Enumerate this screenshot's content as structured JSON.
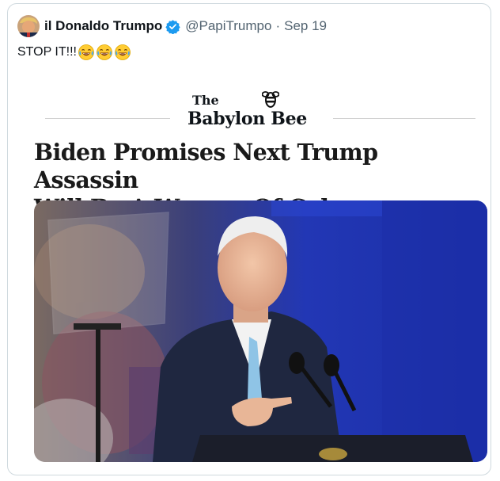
{
  "tweet": {
    "display_name": "il Donaldo Trumpo",
    "handle": "@PapiTrumpo",
    "separator": "·",
    "date": "Sep 19",
    "text": "STOP IT!!!",
    "emojis": [
      "face-with-tears-of-joy",
      "face-with-tears-of-joy",
      "face-with-tears-of-joy"
    ],
    "verified": true
  },
  "card": {
    "logo_the": "The",
    "logo_name": "Babylon Bee",
    "headline_line1": "Biden Promises Next Trump Assassin",
    "headline_line2": "Will Be A Woman Of Color",
    "photo_icon": "speaker-at-podium-photo"
  },
  "colors": {
    "verified_blue": "#1d9bf0",
    "handle_gray": "#536471",
    "border": "#cfd9de",
    "stage_blue": "#1f36b8"
  }
}
